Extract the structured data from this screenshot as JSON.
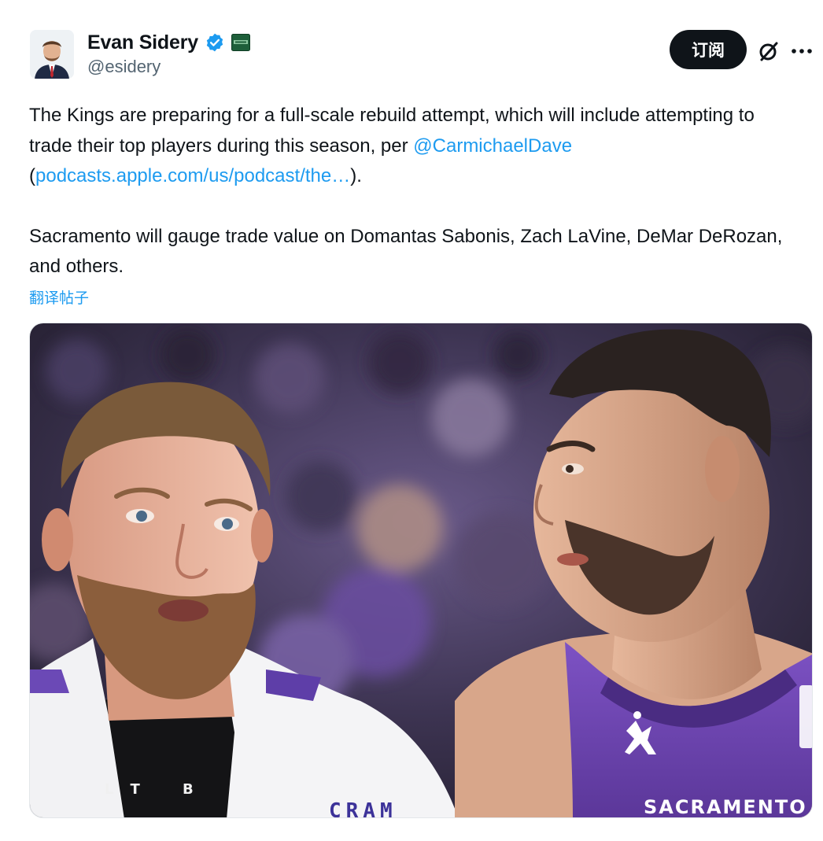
{
  "author": {
    "display_name": "Evan Sidery",
    "handle": "@esidery",
    "verified_icon": "verified-badge-icon",
    "affiliate_icon": "affiliate-badge-icon"
  },
  "actions": {
    "subscribe_label": "订阅",
    "grok_icon": "grok-icon",
    "more_icon": "more-horizontal-icon"
  },
  "tweet": {
    "p1_a": "The Kings are preparing for a full-scale rebuild attempt, which will include attempting to trade their top players during this season, per ",
    "mention": "@CarmichaelDave",
    "p1_b": " (",
    "link": "podcasts.apple.com/us/podcast/the…",
    "p1_c": ").",
    "p2": "Sacramento will gauge trade value on Domantas Sabonis, Zach LaVine, DeMar DeRozan, and others.",
    "translate_label": "翻译帖子"
  },
  "media": {
    "jersey_text": "SACRAMENTO",
    "shirt_text": "LT B",
    "towel_text": "CRAM"
  },
  "colors": {
    "accent": "#1d9bf0",
    "text": "#0f1419",
    "secondary": "#536471",
    "button_bg": "#0f1419",
    "kings_purple": "#6b3fb3"
  }
}
